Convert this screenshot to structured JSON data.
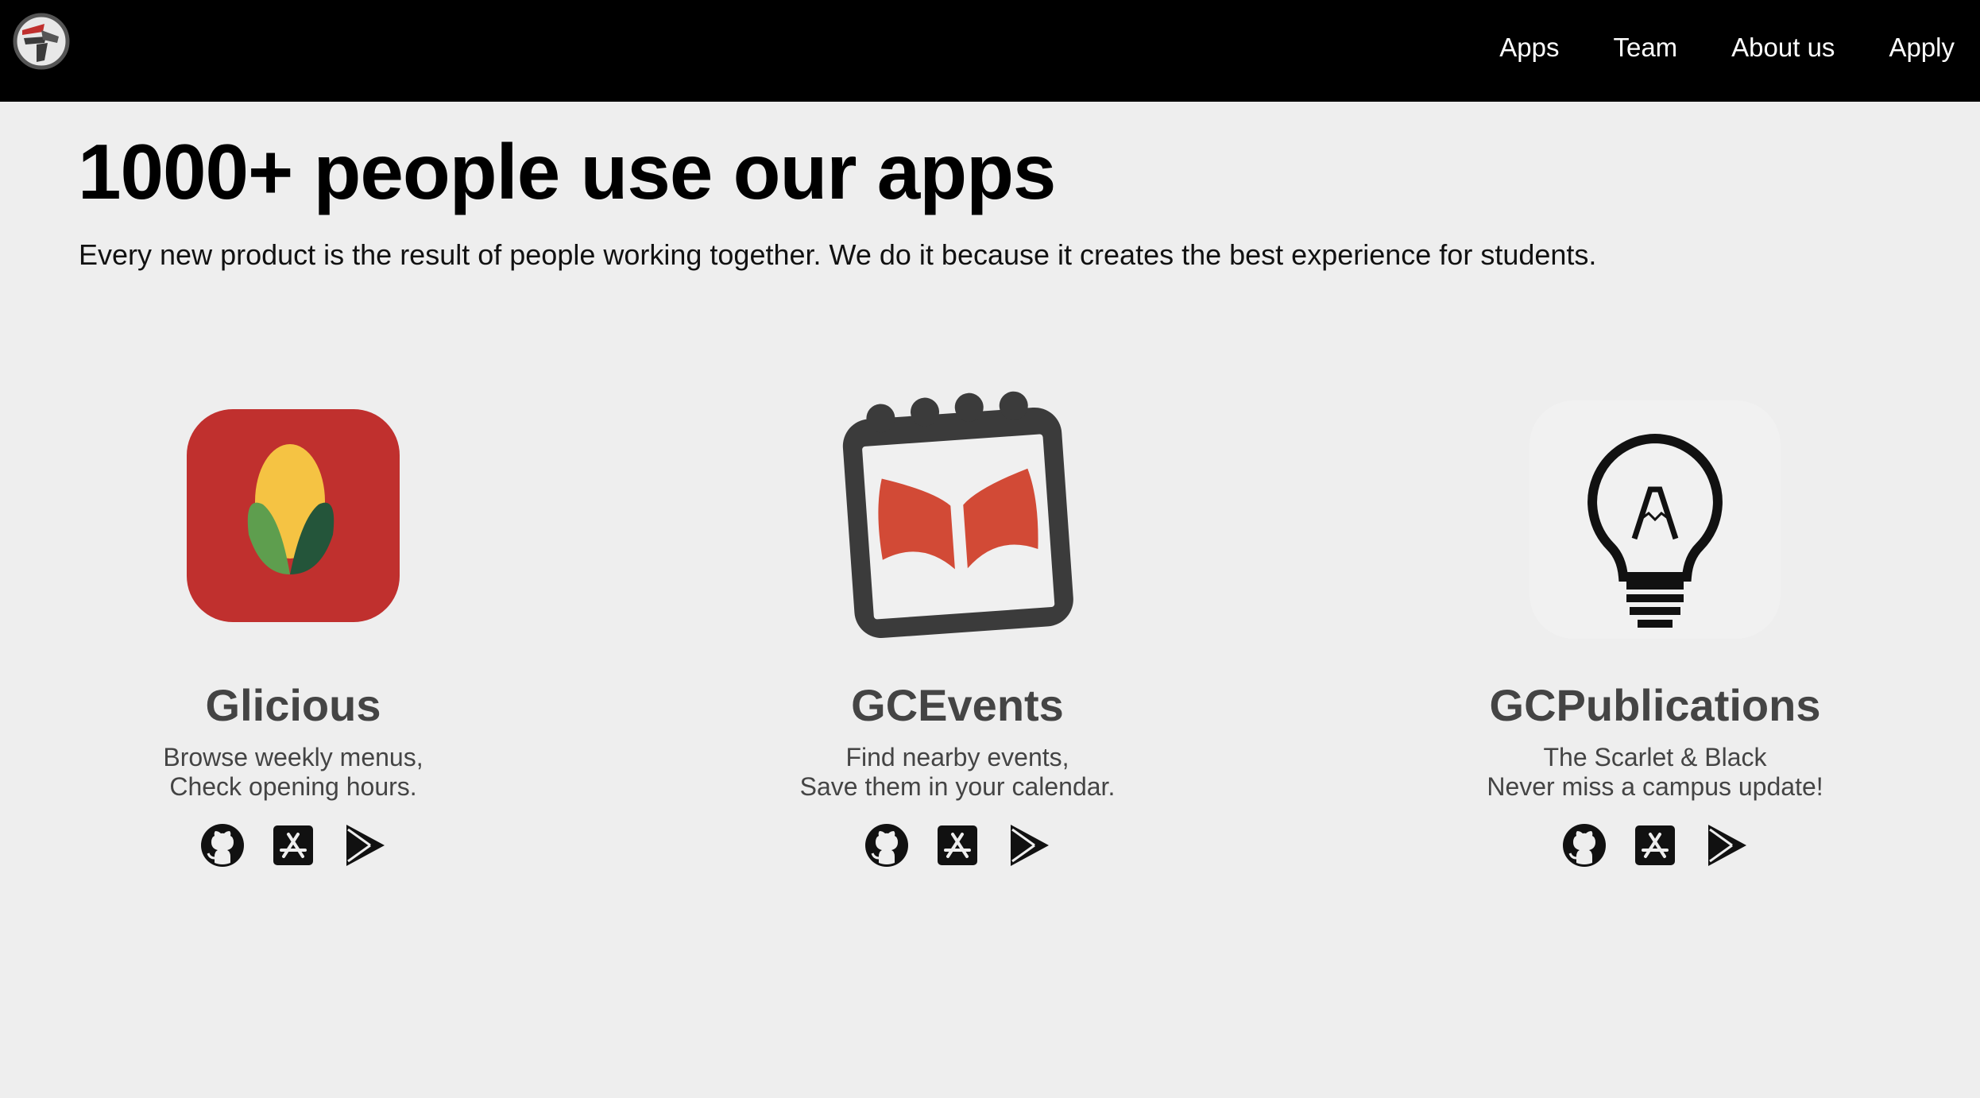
{
  "nav": {
    "items": [
      "Apps",
      "Team",
      "About us",
      "Apply"
    ]
  },
  "hero": {
    "title": "1000+ people use our apps",
    "subtitle": "Every new product is the result of people working together. We do it because it creates the best experience for students."
  },
  "apps": [
    {
      "name": "Glicious",
      "desc_line1": "Browse weekly menus,",
      "desc_line2": "Check opening hours.",
      "icon": "corn-icon"
    },
    {
      "name": "GCEvents",
      "desc_line1": "Find nearby events,",
      "desc_line2": "Save them in your calendar.",
      "icon": "calendar-leaf-icon"
    },
    {
      "name": "GCPublications",
      "desc_line1": "The Scarlet & Black",
      "desc_line2": "Never miss a campus update!",
      "icon": "lightbulb-icon"
    }
  ],
  "colors": {
    "topbar": "#000000",
    "background": "#eeeeee",
    "heading_gray": "#444444",
    "glicious_red": "#c0302e",
    "corn_yellow": "#f5c343",
    "leaf_green": "#2e6b45",
    "events_red": "#d24a36",
    "calendar_dark": "#3b3b3b"
  }
}
